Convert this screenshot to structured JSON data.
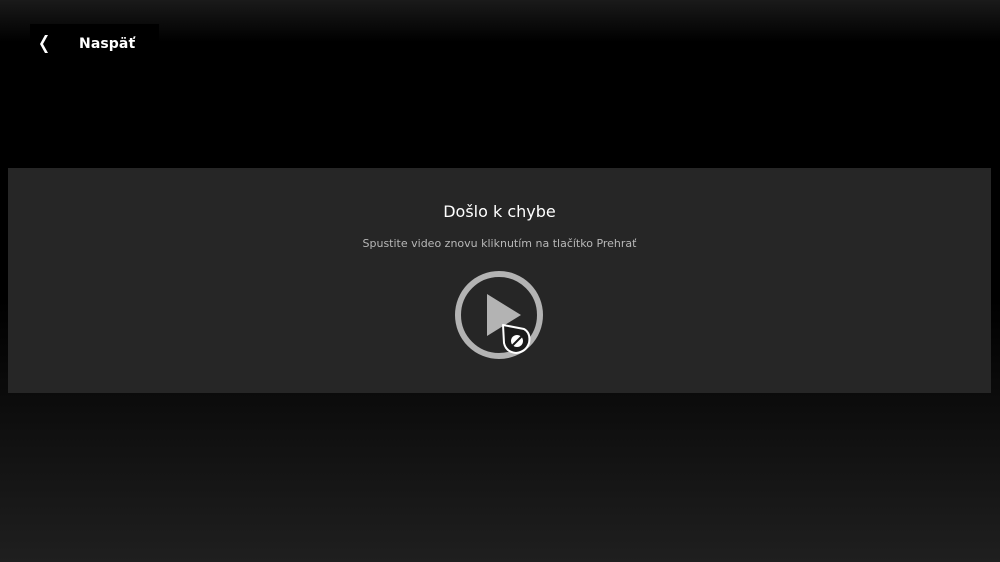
{
  "nav": {
    "back_label": "Naspäť",
    "back_icon": "chevron-left-icon"
  },
  "error": {
    "title": "Došlo k chybe",
    "message": "Spustite video znovu kliknutím na tlačítko Prehrať",
    "play_icon": "play-circle-icon"
  },
  "colors": {
    "page_background": "#000000",
    "panel_background": "#262626",
    "title_text": "#ffffff",
    "hint_text": "#b8b8b8",
    "play_icon": "#b3b3b3"
  }
}
